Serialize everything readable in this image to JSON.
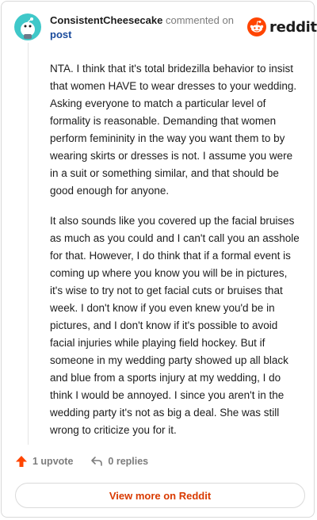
{
  "header": {
    "author": "ConsistentCheesecake",
    "action_text": "commented on",
    "post_link": "post",
    "brand_name": "reddit",
    "brand_color": "#FF4500"
  },
  "comment": {
    "paragraphs": [
      "NTA. I think that it's total bridezilla behavior to insist that women HAVE to wear dresses to your wedding. Asking everyone to match a particular level of formality is reasonable. Demanding that women perform femininity in the way you want them to by wearing skirts or dresses is not. I assume you were in a suit or something similar, and that should be good enough for anyone.",
      "It also sounds like you covered up the facial bruises as much as you could and I can't call you an asshole for that. However, I do think that if a formal event is coming up where you know you will be in pictures, it's wise to try not to get facial cuts or bruises that week. I don't know if you even knew you'd be in pictures, and I don't know if it's possible to avoid facial injuries while playing field hockey. But if someone in my wedding party showed up all black and blue from a sports injury at my wedding, I do think I would be annoyed. I since you aren't in the wedding party it's not as big a deal. She was still wrong to criticize you for it."
    ]
  },
  "actions": {
    "upvote_label": "1 upvote",
    "replies_label": "0 replies",
    "upvote_icon": "upvote-arrow-icon",
    "reply_icon": "reply-arrow-icon",
    "upvote_color": "#FF4500"
  },
  "footer": {
    "view_more_label": "View more on Reddit"
  }
}
